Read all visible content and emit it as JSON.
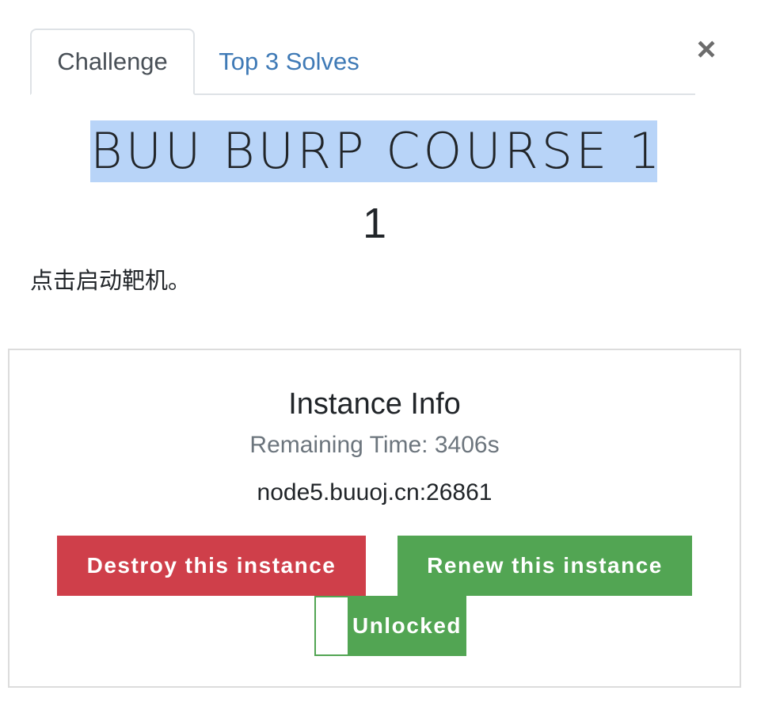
{
  "tabs": [
    {
      "label": "Challenge",
      "active": true
    },
    {
      "label": "Top 3 Solves",
      "active": false
    }
  ],
  "close_symbol": "×",
  "challenge": {
    "name": "BUU BURP COURSE 1",
    "value": "1",
    "description": "点击启动靶机。"
  },
  "instance": {
    "title": "Instance Info",
    "remaining_time": "Remaining Time: 3406s",
    "host": "node5.buuoj.cn:26861",
    "destroy_label": "Destroy this instance",
    "renew_label": "Renew this instance",
    "lock_label": "Unlocked"
  },
  "colors": {
    "link": "#3f7ab6",
    "danger": "#cf3f4a",
    "success": "#52a553",
    "selection": "#b8d4f8",
    "muted": "#6c757d"
  }
}
